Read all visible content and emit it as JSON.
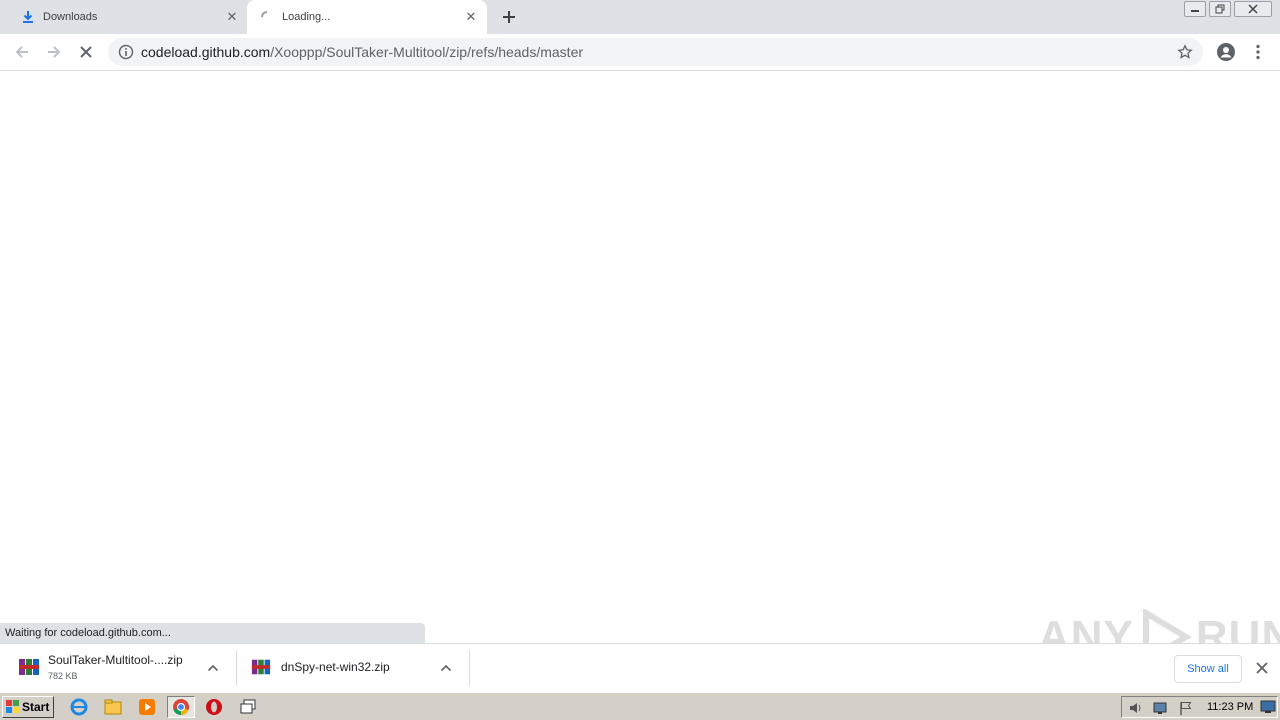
{
  "tabs": [
    {
      "label": "Downloads",
      "icon": "download-icon"
    },
    {
      "label": "Loading...",
      "icon": "spinner-icon"
    }
  ],
  "toolbar": {
    "url_host": "codeload.github.com",
    "url_path": "/Xooppp/SoulTaker-Multitool/zip/refs/heads/master"
  },
  "status": {
    "text": "Waiting for codeload.github.com..."
  },
  "downloads": [
    {
      "name": "SoulTaker-Multitool-....zip",
      "size": "782 KB",
      "icon": "winrar-icon"
    },
    {
      "name": "dnSpy-net-win32.zip",
      "size": "",
      "icon": "winrar-icon"
    }
  ],
  "shelf": {
    "show_all": "Show all"
  },
  "watermark": {
    "text_left": "ANY",
    "text_right": "RUN"
  },
  "taskbar": {
    "start_label": "Start",
    "clock": "11:23 PM",
    "pinned": [
      "ie-icon",
      "explorer-icon",
      "media-player-icon",
      "chrome-icon",
      "opera-icon",
      "switch-windows-icon"
    ]
  },
  "colors": {
    "tab_strip": "#dee1e6",
    "accent_blue": "#1a73e8",
    "taskbar": "#d4d0c8"
  }
}
